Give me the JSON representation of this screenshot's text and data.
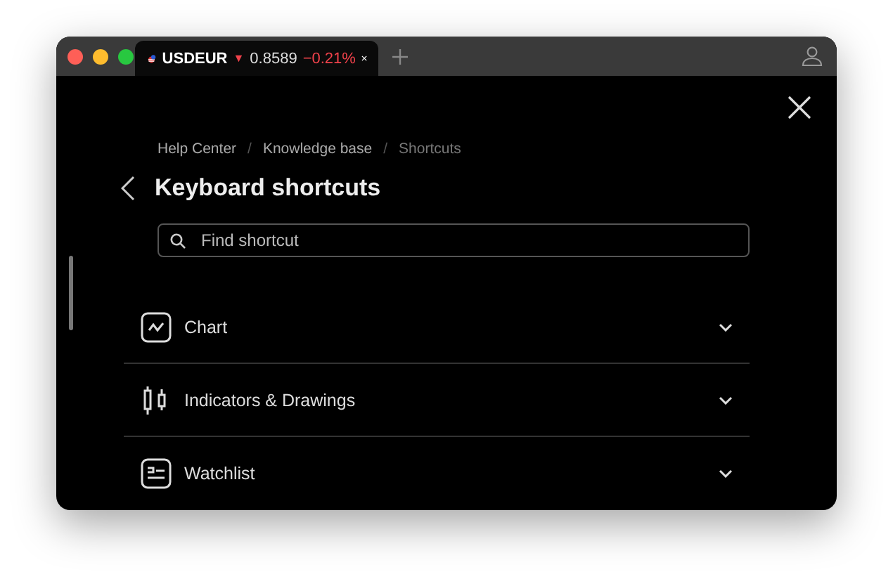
{
  "browser": {
    "tabs": [
      {
        "symbol": "USDEUR",
        "arrow": "▼",
        "falling": true,
        "price": "0.8589",
        "change": "−0.21%",
        "selected": true
      }
    ]
  },
  "breadcrumb": [
    {
      "label": "Help Center",
      "current": false
    },
    {
      "separator": "/",
      "label": "Knowledge base",
      "current": false
    },
    {
      "separator": "/",
      "label": "Shortcuts",
      "current": true
    }
  ],
  "title": "Keyboard shortcuts",
  "search": {
    "placeholder": "Find shortcut"
  },
  "sections": [
    {
      "label": "Chart",
      "kind": "chart",
      "expanded": false
    },
    {
      "label": "Indicators & Drawings",
      "kind": "indicators",
      "expanded": false
    },
    {
      "label": "Watchlist",
      "kind": "watchlist",
      "expanded": false
    }
  ]
}
